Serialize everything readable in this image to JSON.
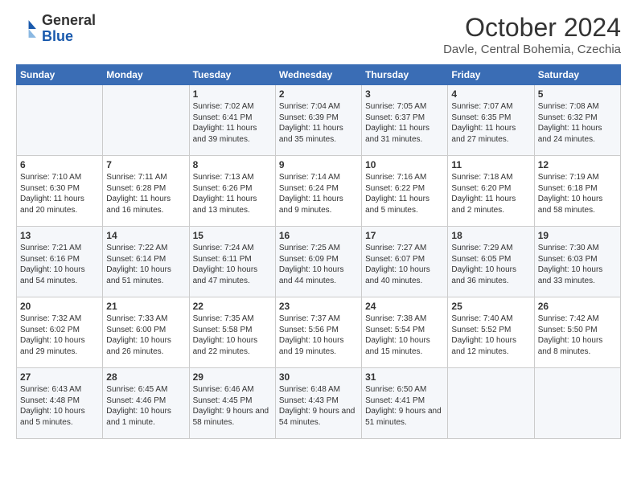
{
  "header": {
    "logo_line1": "General",
    "logo_line2": "Blue",
    "month": "October 2024",
    "location": "Davle, Central Bohemia, Czechia"
  },
  "days_of_week": [
    "Sunday",
    "Monday",
    "Tuesday",
    "Wednesday",
    "Thursday",
    "Friday",
    "Saturday"
  ],
  "weeks": [
    [
      {
        "day": "",
        "info": ""
      },
      {
        "day": "",
        "info": ""
      },
      {
        "day": "1",
        "info": "Sunrise: 7:02 AM\nSunset: 6:41 PM\nDaylight: 11 hours and 39 minutes."
      },
      {
        "day": "2",
        "info": "Sunrise: 7:04 AM\nSunset: 6:39 PM\nDaylight: 11 hours and 35 minutes."
      },
      {
        "day": "3",
        "info": "Sunrise: 7:05 AM\nSunset: 6:37 PM\nDaylight: 11 hours and 31 minutes."
      },
      {
        "day": "4",
        "info": "Sunrise: 7:07 AM\nSunset: 6:35 PM\nDaylight: 11 hours and 27 minutes."
      },
      {
        "day": "5",
        "info": "Sunrise: 7:08 AM\nSunset: 6:32 PM\nDaylight: 11 hours and 24 minutes."
      }
    ],
    [
      {
        "day": "6",
        "info": "Sunrise: 7:10 AM\nSunset: 6:30 PM\nDaylight: 11 hours and 20 minutes."
      },
      {
        "day": "7",
        "info": "Sunrise: 7:11 AM\nSunset: 6:28 PM\nDaylight: 11 hours and 16 minutes."
      },
      {
        "day": "8",
        "info": "Sunrise: 7:13 AM\nSunset: 6:26 PM\nDaylight: 11 hours and 13 minutes."
      },
      {
        "day": "9",
        "info": "Sunrise: 7:14 AM\nSunset: 6:24 PM\nDaylight: 11 hours and 9 minutes."
      },
      {
        "day": "10",
        "info": "Sunrise: 7:16 AM\nSunset: 6:22 PM\nDaylight: 11 hours and 5 minutes."
      },
      {
        "day": "11",
        "info": "Sunrise: 7:18 AM\nSunset: 6:20 PM\nDaylight: 11 hours and 2 minutes."
      },
      {
        "day": "12",
        "info": "Sunrise: 7:19 AM\nSunset: 6:18 PM\nDaylight: 10 hours and 58 minutes."
      }
    ],
    [
      {
        "day": "13",
        "info": "Sunrise: 7:21 AM\nSunset: 6:16 PM\nDaylight: 10 hours and 54 minutes."
      },
      {
        "day": "14",
        "info": "Sunrise: 7:22 AM\nSunset: 6:14 PM\nDaylight: 10 hours and 51 minutes."
      },
      {
        "day": "15",
        "info": "Sunrise: 7:24 AM\nSunset: 6:11 PM\nDaylight: 10 hours and 47 minutes."
      },
      {
        "day": "16",
        "info": "Sunrise: 7:25 AM\nSunset: 6:09 PM\nDaylight: 10 hours and 44 minutes."
      },
      {
        "day": "17",
        "info": "Sunrise: 7:27 AM\nSunset: 6:07 PM\nDaylight: 10 hours and 40 minutes."
      },
      {
        "day": "18",
        "info": "Sunrise: 7:29 AM\nSunset: 6:05 PM\nDaylight: 10 hours and 36 minutes."
      },
      {
        "day": "19",
        "info": "Sunrise: 7:30 AM\nSunset: 6:03 PM\nDaylight: 10 hours and 33 minutes."
      }
    ],
    [
      {
        "day": "20",
        "info": "Sunrise: 7:32 AM\nSunset: 6:02 PM\nDaylight: 10 hours and 29 minutes."
      },
      {
        "day": "21",
        "info": "Sunrise: 7:33 AM\nSunset: 6:00 PM\nDaylight: 10 hours and 26 minutes."
      },
      {
        "day": "22",
        "info": "Sunrise: 7:35 AM\nSunset: 5:58 PM\nDaylight: 10 hours and 22 minutes."
      },
      {
        "day": "23",
        "info": "Sunrise: 7:37 AM\nSunset: 5:56 PM\nDaylight: 10 hours and 19 minutes."
      },
      {
        "day": "24",
        "info": "Sunrise: 7:38 AM\nSunset: 5:54 PM\nDaylight: 10 hours and 15 minutes."
      },
      {
        "day": "25",
        "info": "Sunrise: 7:40 AM\nSunset: 5:52 PM\nDaylight: 10 hours and 12 minutes."
      },
      {
        "day": "26",
        "info": "Sunrise: 7:42 AM\nSunset: 5:50 PM\nDaylight: 10 hours and 8 minutes."
      }
    ],
    [
      {
        "day": "27",
        "info": "Sunrise: 6:43 AM\nSunset: 4:48 PM\nDaylight: 10 hours and 5 minutes."
      },
      {
        "day": "28",
        "info": "Sunrise: 6:45 AM\nSunset: 4:46 PM\nDaylight: 10 hours and 1 minute."
      },
      {
        "day": "29",
        "info": "Sunrise: 6:46 AM\nSunset: 4:45 PM\nDaylight: 9 hours and 58 minutes."
      },
      {
        "day": "30",
        "info": "Sunrise: 6:48 AM\nSunset: 4:43 PM\nDaylight: 9 hours and 54 minutes."
      },
      {
        "day": "31",
        "info": "Sunrise: 6:50 AM\nSunset: 4:41 PM\nDaylight: 9 hours and 51 minutes."
      },
      {
        "day": "",
        "info": ""
      },
      {
        "day": "",
        "info": ""
      }
    ]
  ]
}
